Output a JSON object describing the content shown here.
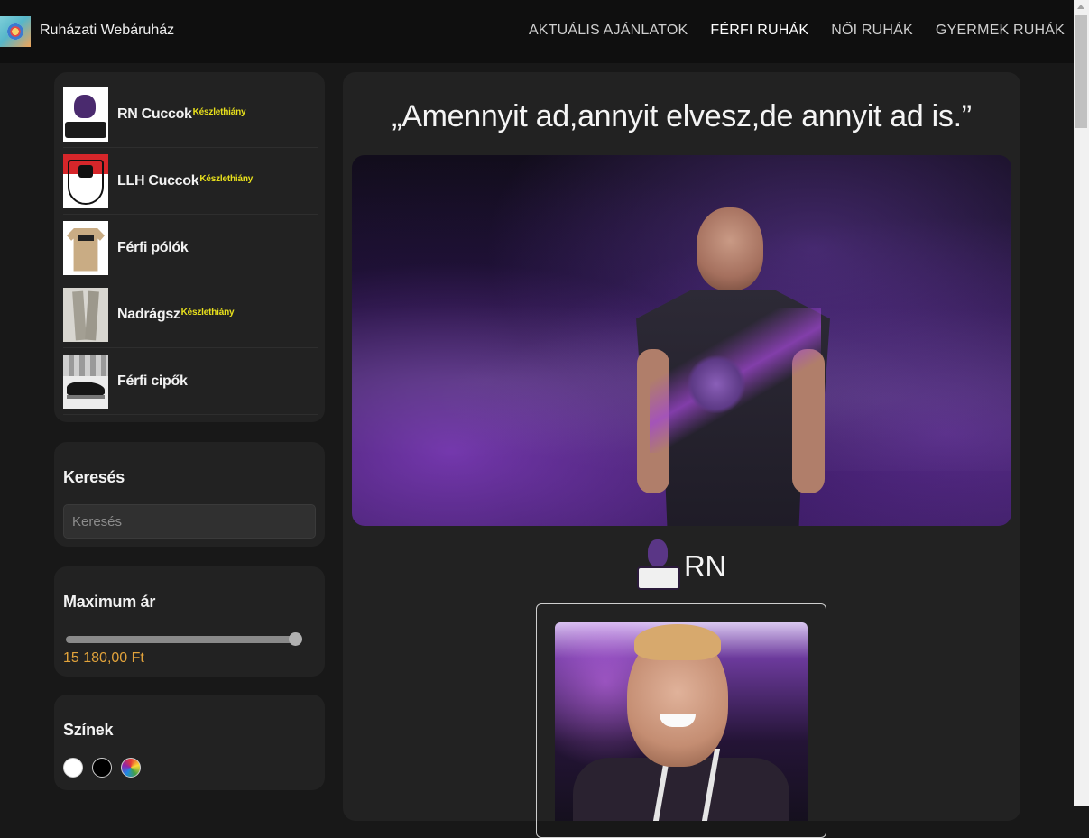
{
  "header": {
    "brand_title": "Ruházati Webáruház",
    "nav": [
      {
        "label": "AKTUÁLIS AJÁNLATOK"
      },
      {
        "label": "FÉRFI RUHÁK"
      },
      {
        "label": "NŐI RUHÁK"
      },
      {
        "label": "GYERMEK RUHÁK"
      }
    ],
    "active_nav": "FÉRFI RUHÁK"
  },
  "sidebar": {
    "categories": [
      {
        "label": "RN Cuccok",
        "badge": "Készlethiány",
        "icon": "rapid-ninjas-logo"
      },
      {
        "label": "LLH Cuccok",
        "badge": "Készlethiány",
        "icon": "honved-shield-logo"
      },
      {
        "label": "Férfi pólók",
        "badge": "",
        "icon": "tshirt-photo"
      },
      {
        "label": "Nadrágsz",
        "badge": "Készlethiány",
        "icon": "trousers-photo"
      },
      {
        "label": "Férfi cipők",
        "badge": "",
        "icon": "shoes-photo"
      }
    ],
    "search": {
      "heading": "Keresés",
      "placeholder": "Keresés",
      "value": ""
    },
    "price": {
      "heading": "Maximum ár",
      "value_text": "15 180,00 Ft",
      "slider_fraction": 1.0
    },
    "colors": {
      "heading": "Színek",
      "swatches": [
        {
          "name": "white",
          "color": "#ffffff"
        },
        {
          "name": "black",
          "color": "#000000"
        },
        {
          "name": "rainbow",
          "color": "multicolor"
        }
      ]
    }
  },
  "main": {
    "quote": "„Amennyit ad,annyit elvesz,de annyit ad is.”",
    "hero_image": "rapid-ninjas-player-photo",
    "brand_name": "RN",
    "product_image": "smiling-player-photo"
  },
  "colors": {
    "page_bg": "#181818",
    "card_bg": "#222222",
    "navbar_bg": "#0f0f0f",
    "badge": "#e8e01c",
    "price": "#e2a33b"
  }
}
